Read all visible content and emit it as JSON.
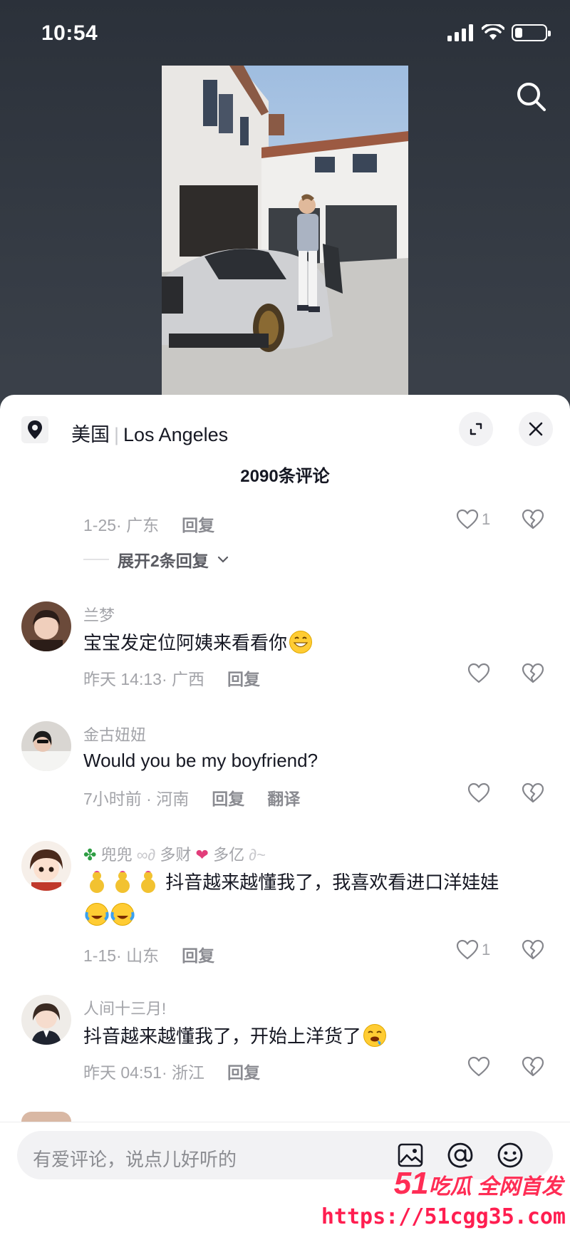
{
  "status": {
    "time": "10:54",
    "battery_level": 0.25
  },
  "location": {
    "country": "美国",
    "city": "Los Angeles"
  },
  "comments_header": {
    "count_label": "2090条评论"
  },
  "prev_comment": {
    "date": "1-25",
    "region": "广东",
    "reply_label": "回复",
    "like_count": "1",
    "expand_label": "展开2条回复"
  },
  "comments": [
    {
      "name": "兰梦",
      "text": "宝宝发定位阿姨来看看你",
      "time": "昨天 14:13",
      "region": "广西",
      "reply_label": "回复",
      "like_count": ""
    },
    {
      "name": "金古妞妞",
      "text": "Would you be my boyfriend?",
      "time": "7小时前",
      "region": "河南",
      "reply_label": "回复",
      "translate_label": "翻译",
      "like_count": ""
    },
    {
      "name": "兜兜",
      "name_extra_1": "多财",
      "name_extra_2": "多亿",
      "text": "抖音越来越懂我了，我喜欢看进口洋娃娃",
      "time": "1-15",
      "region": "山东",
      "reply_label": "回复",
      "like_count": "1"
    },
    {
      "name": "人间十三月!",
      "text": "抖音越来越懂我了，开始上洋货了",
      "time": "昨天 04:51",
      "region": "浙江",
      "reply_label": "回复",
      "like_count": ""
    }
  ],
  "input": {
    "placeholder": "有爱评论，说点儿好听的"
  },
  "watermark": {
    "brand_num": "51",
    "brand_text": "吃瓜 全网首发",
    "url": "https://51cgg35.com"
  },
  "icons": {
    "search": "search-icon",
    "location": "location-pin-icon",
    "expand": "expand-icon",
    "close": "close-icon",
    "like": "heart-icon",
    "dislike": "broken-heart-icon",
    "image": "image-icon",
    "mention": "at-icon",
    "emoji": "smile-icon"
  },
  "colors": {
    "accent": "#ff2d55",
    "text": "#161823",
    "secondary": "#a3a4a9"
  }
}
